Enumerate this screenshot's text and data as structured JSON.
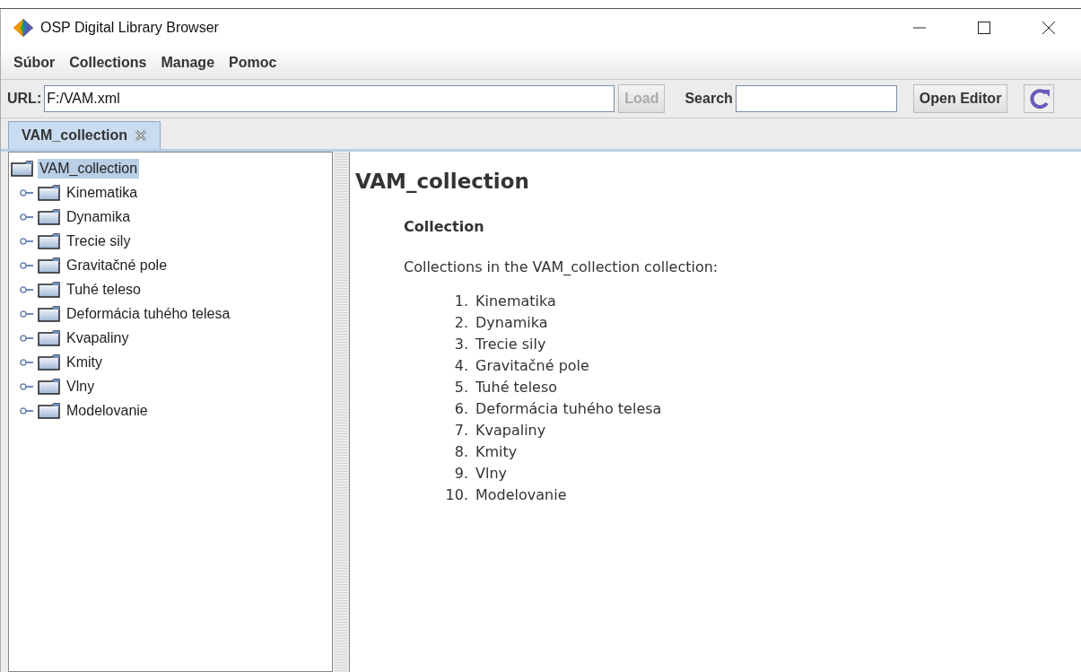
{
  "window": {
    "title": "OSP Digital Library Browser"
  },
  "menu": [
    "Súbor",
    "Collections",
    "Manage",
    "Pomoc"
  ],
  "toolbar": {
    "url_label": "URL:",
    "url_value": "F:/VAM.xml",
    "load_button": {
      "label": "Load",
      "disabled": true
    },
    "search_label": "Search",
    "open_editor_button": "Open Editor"
  },
  "tabs": [
    {
      "label": "VAM_collection",
      "selected": true
    }
  ],
  "tree": {
    "label": "VAM_collection",
    "selected": true,
    "children": [
      {
        "label": "Kinematika",
        "selected": false
      },
      {
        "label": "Dynamika",
        "selected": false
      },
      {
        "label": "Trecie sily",
        "selected": false
      },
      {
        "label": "Gravitačné pole",
        "selected": false
      },
      {
        "label": "Tuhé teleso",
        "selected": false
      },
      {
        "label": "Deformácia tuhého telesa",
        "selected": false
      },
      {
        "label": "Kvapaliny",
        "selected": false
      },
      {
        "label": "Kmity",
        "selected": false
      },
      {
        "label": "Vlny",
        "selected": false
      },
      {
        "label": "Modelovanie",
        "selected": false
      }
    ]
  },
  "content": {
    "title": "VAM_collection",
    "subtitle": "Collection",
    "intro": "Collections in the VAM_collection collection:",
    "items": [
      {
        "number": "1.",
        "label": "Kinematika"
      },
      {
        "number": "2.",
        "label": "Dynamika"
      },
      {
        "number": "3.",
        "label": "Trecie sily"
      },
      {
        "number": "4.",
        "label": "Gravitačné pole"
      },
      {
        "number": "5.",
        "label": "Tuhé teleso"
      },
      {
        "number": "6.",
        "label": "Deformácia tuhého telesa"
      },
      {
        "number": "7.",
        "label": "Kvapaliny"
      },
      {
        "number": "8.",
        "label": "Kmity"
      },
      {
        "number": "9.",
        "label": "Vlny"
      },
      {
        "number": "10.",
        "label": "Modelovanie"
      }
    ]
  }
}
